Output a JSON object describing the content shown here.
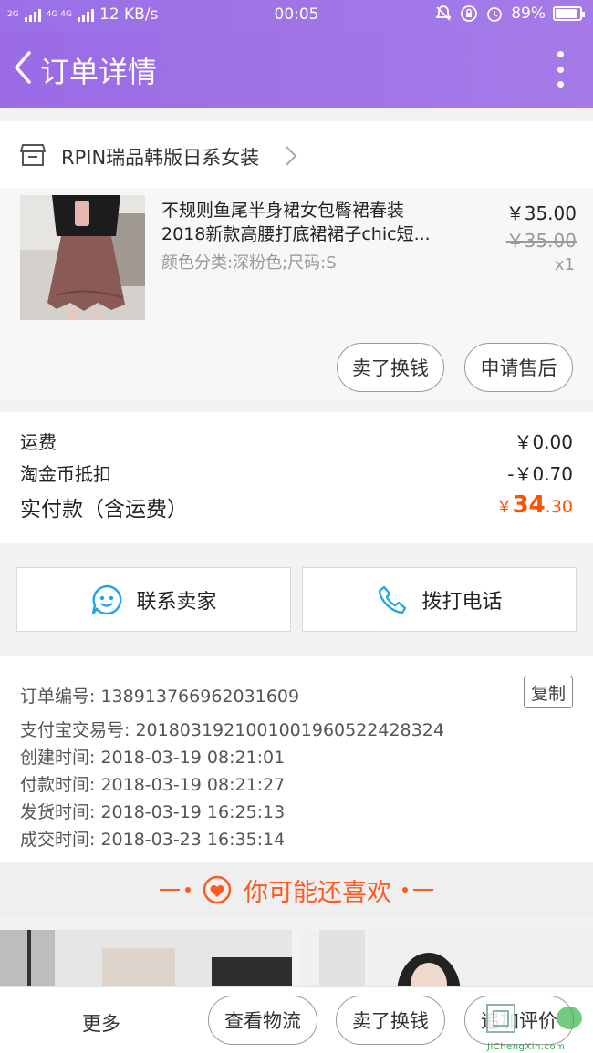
{
  "status_bar": {
    "network_1": "2G",
    "network_2": "4G 4G",
    "speed": "12 KB/s",
    "time": "00:05",
    "battery": "89%",
    "battery_level": 0.89
  },
  "nav": {
    "title": "订单详情"
  },
  "shop": {
    "name": "RPIN瑞品韩版日系女装"
  },
  "product": {
    "title_line1": "不规则鱼尾半身裙女包臀裙春装",
    "title_line2": "2018新款高腰打底裙裙子chic短...",
    "sku": "颜色分类:深粉色;尺码:S",
    "price": "￥35.00",
    "original_price": "￥35.00",
    "quantity": "x1",
    "btn_resell": "卖了换钱",
    "btn_aftersale": "申请售后"
  },
  "fees": {
    "shipping_label": "运费",
    "shipping_value": "￥0.00",
    "coin_label": "淘金币抵扣",
    "coin_value": "-￥0.70",
    "total_label": "实付款（含运费）",
    "total_yen": "￥",
    "total_int": "34",
    "total_dec": ".30"
  },
  "contact": {
    "seller_label": "联系卖家",
    "phone_label": "拨打电话"
  },
  "order_info": {
    "order_no": "订单编号: 138913766962031609",
    "copy_label": "复制",
    "alipay_no": "支付宝交易号: 2018031921001001960522428324",
    "created": "创建时间:  2018-03-19 08:21:01",
    "paid": "付款时间:  2018-03-19 08:21:27",
    "shipped": "发货时间:  2018-03-19 16:25:13",
    "closed": "成交时间:  2018-03-23 16:35:14"
  },
  "recommend": {
    "title": "你可能还喜欢"
  },
  "bottom_bar": {
    "more": "更多",
    "logistics": "查看物流",
    "resell": "卖了换钱",
    "review": "追加评价"
  },
  "watermark": {
    "text": "JiChengXin.com"
  },
  "colors": {
    "nav": "#9a6be5",
    "accent": "#ff5000",
    "icon_blue": "#1fa6e8"
  }
}
